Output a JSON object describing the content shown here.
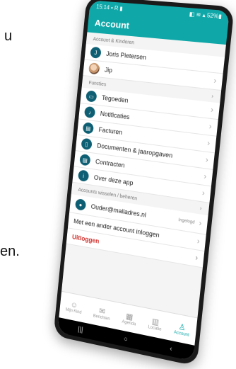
{
  "side_text": {
    "top_right": "u",
    "mid_right": "en."
  },
  "status": {
    "time": "15:14",
    "left_icons": "▪ R ▮",
    "right_icons": "◧ ≋ ▴ 52%▮"
  },
  "header": {
    "title": "Account"
  },
  "sections": {
    "account": "Account & Kinderen",
    "functions": "Functies",
    "switch": "Accounts wisselen / beheren"
  },
  "accounts": [
    {
      "initial": "J",
      "name": "Joris Pietersen"
    },
    {
      "name": "Jip"
    }
  ],
  "functions": [
    {
      "label": "Tegoeden",
      "icon": "wallet-icon",
      "glyph": "▭"
    },
    {
      "label": "Notificaties",
      "icon": "bell-icon",
      "glyph": "♪"
    },
    {
      "label": "Facturen",
      "icon": "invoice-icon",
      "glyph": "▤"
    },
    {
      "label": "Documenten & jaaropgaven",
      "icon": "document-icon",
      "glyph": "▯"
    },
    {
      "label": "Contracten",
      "icon": "contract-icon",
      "glyph": "▤"
    },
    {
      "label": "Over deze app",
      "icon": "info-icon",
      "glyph": "i"
    }
  ],
  "login": {
    "email": "Ouder@mailadres.nl",
    "status": "Ingelogd",
    "other": "Met een ander account inloggen",
    "logout": "Uitloggen"
  },
  "nav": [
    {
      "label": "Mijn Kind",
      "glyph": "☺",
      "active": false
    },
    {
      "label": "Berichten",
      "glyph": "✉",
      "active": false
    },
    {
      "label": "Agenda",
      "glyph": "▦",
      "active": false
    },
    {
      "label": "Locatie",
      "glyph": "▥",
      "active": false
    },
    {
      "label": "Account",
      "glyph": "♙",
      "active": true
    }
  ],
  "system_nav": {
    "recent": "|||",
    "home": "○",
    "back": "‹"
  },
  "colors": {
    "brand": "#0fa7a8",
    "icon": "#0e5f73",
    "logout": "#d0312d"
  }
}
